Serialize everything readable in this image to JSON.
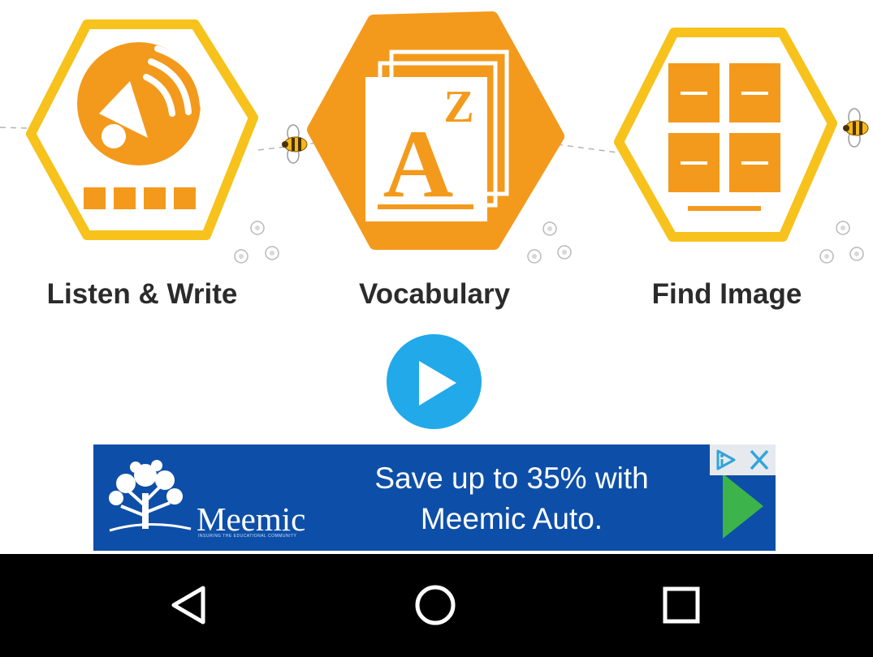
{
  "modules": [
    {
      "label": "Listen & Write",
      "icon": "speaker-icon"
    },
    {
      "label": "Vocabulary",
      "icon": "vocabulary-book-icon"
    },
    {
      "label": "Find Image",
      "icon": "image-grid-icon"
    }
  ],
  "play_button": {
    "icon": "play-icon",
    "color": "#21a9ea"
  },
  "ad": {
    "brand": "Meemic",
    "brand_tagline": "INSURING THE EDUCATIONAL COMMUNITY",
    "headline_line1": "Save up to 35% with",
    "headline_line2": "Meemic Auto.",
    "background": "#0d4fa8",
    "cta_icon": "green-arrow-icon",
    "adchoices_icon": "adchoices-icon",
    "close_icon": "close-icon"
  },
  "navigation_bar": {
    "back_icon": "back-icon",
    "home_icon": "home-icon",
    "recents_icon": "recents-icon"
  },
  "colors": {
    "accent": "#f39a1c",
    "hex_border": "#f7c21c",
    "label": "#2b2b2b"
  }
}
